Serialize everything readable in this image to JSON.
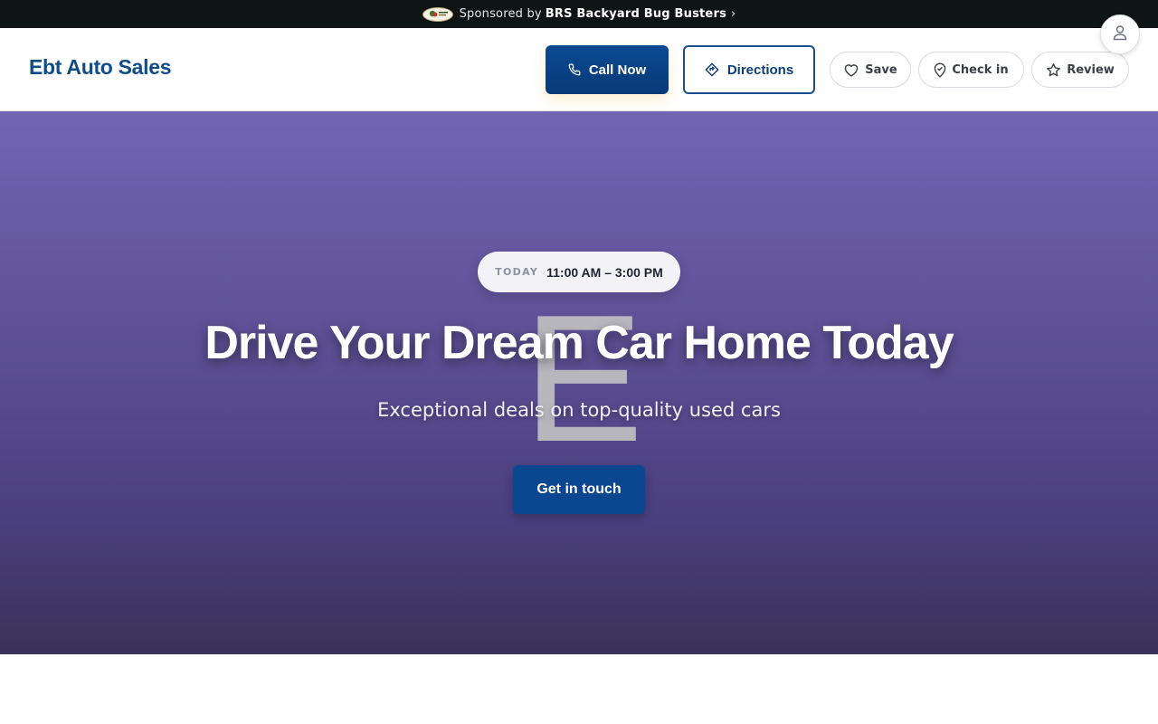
{
  "sponsor": {
    "prefix": "Sponsored by",
    "name": "BRS Backyard Bug Busters",
    "chevron": "›",
    "logo_icon": "sponsor-logo"
  },
  "header": {
    "brand": "Ebt Auto Sales",
    "call_label": "Call Now",
    "directions_label": "Directions",
    "save_label": "Save",
    "checkin_label": "Check in",
    "review_label": "Review",
    "icons": {
      "call": "phone-icon",
      "directions": "directions-icon",
      "save": "heart-icon",
      "checkin": "map-pin-icon",
      "review": "star-icon",
      "user": "user-icon"
    }
  },
  "hero": {
    "hours_label": "TODAY",
    "hours_value": "11:00 AM – 3:00 PM",
    "title": "Drive Your Dream Car Home Today",
    "subtitle": "Exceptional deals on top-quality used cars",
    "cta_label": "Get in touch",
    "watermark_letter": "E"
  },
  "colors": {
    "sponsor_bg": "#0f1514",
    "brand_text": "#104d87",
    "primary": "#0b4690",
    "hero_top": "#7265b3",
    "hero_bottom": "#3a3259"
  }
}
